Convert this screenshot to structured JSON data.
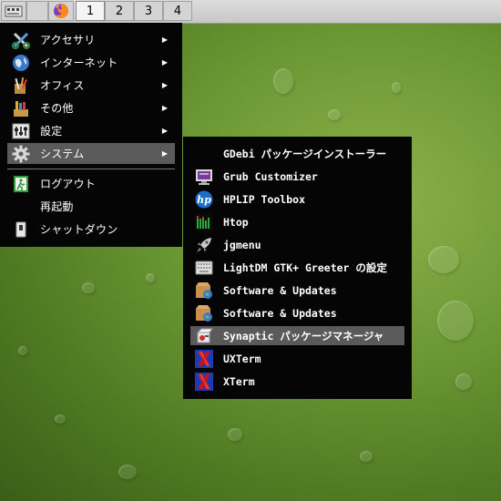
{
  "panel": {
    "workspaces": [
      "1",
      "2",
      "3",
      "4"
    ],
    "active_workspace": "1"
  },
  "main_menu": {
    "items": [
      {
        "label": "アクセサリ",
        "icon": "accessories-icon",
        "submenu": true
      },
      {
        "label": "インターネット",
        "icon": "internet-globe-icon",
        "submenu": true
      },
      {
        "label": "オフィス",
        "icon": "office-icon",
        "submenu": true
      },
      {
        "label": "その他",
        "icon": "other-icon",
        "submenu": true
      },
      {
        "label": "設定",
        "icon": "settings-icon",
        "submenu": true
      },
      {
        "label": "システム",
        "icon": "system-gear-icon",
        "submenu": true,
        "highlighted": true
      }
    ],
    "logout_label": "ログアウト",
    "reboot_label": "再起動",
    "shutdown_label": "シャットダウン",
    "submenu_arrow": "▶"
  },
  "system_submenu": {
    "items": [
      {
        "label": "GDebi パッケージインストーラー",
        "icon": "gdebi-icon"
      },
      {
        "label": "Grub Customizer",
        "icon": "monitor-icon"
      },
      {
        "label": "HPLIP Toolbox",
        "icon": "hp-icon"
      },
      {
        "label": "Htop",
        "icon": "htop-icon"
      },
      {
        "label": "jgmenu",
        "icon": "rocket-icon"
      },
      {
        "label": "LightDM GTK+ Greeter の設定",
        "icon": "keyboard-icon"
      },
      {
        "label": "Software & Updates",
        "icon": "software-updates-icon"
      },
      {
        "label": "Software & Updates",
        "icon": "software-updates-icon"
      },
      {
        "label": "Synaptic パッケージマネージャ",
        "icon": "synaptic-icon",
        "highlighted": true
      },
      {
        "label": "UXTerm",
        "icon": "x-terminal-icon"
      },
      {
        "label": "XTerm",
        "icon": "x-terminal-icon"
      }
    ]
  },
  "colors": {
    "menu_bg": "#050505",
    "highlight": "#5a5a5a",
    "desktop_green": "#6e9a36"
  }
}
